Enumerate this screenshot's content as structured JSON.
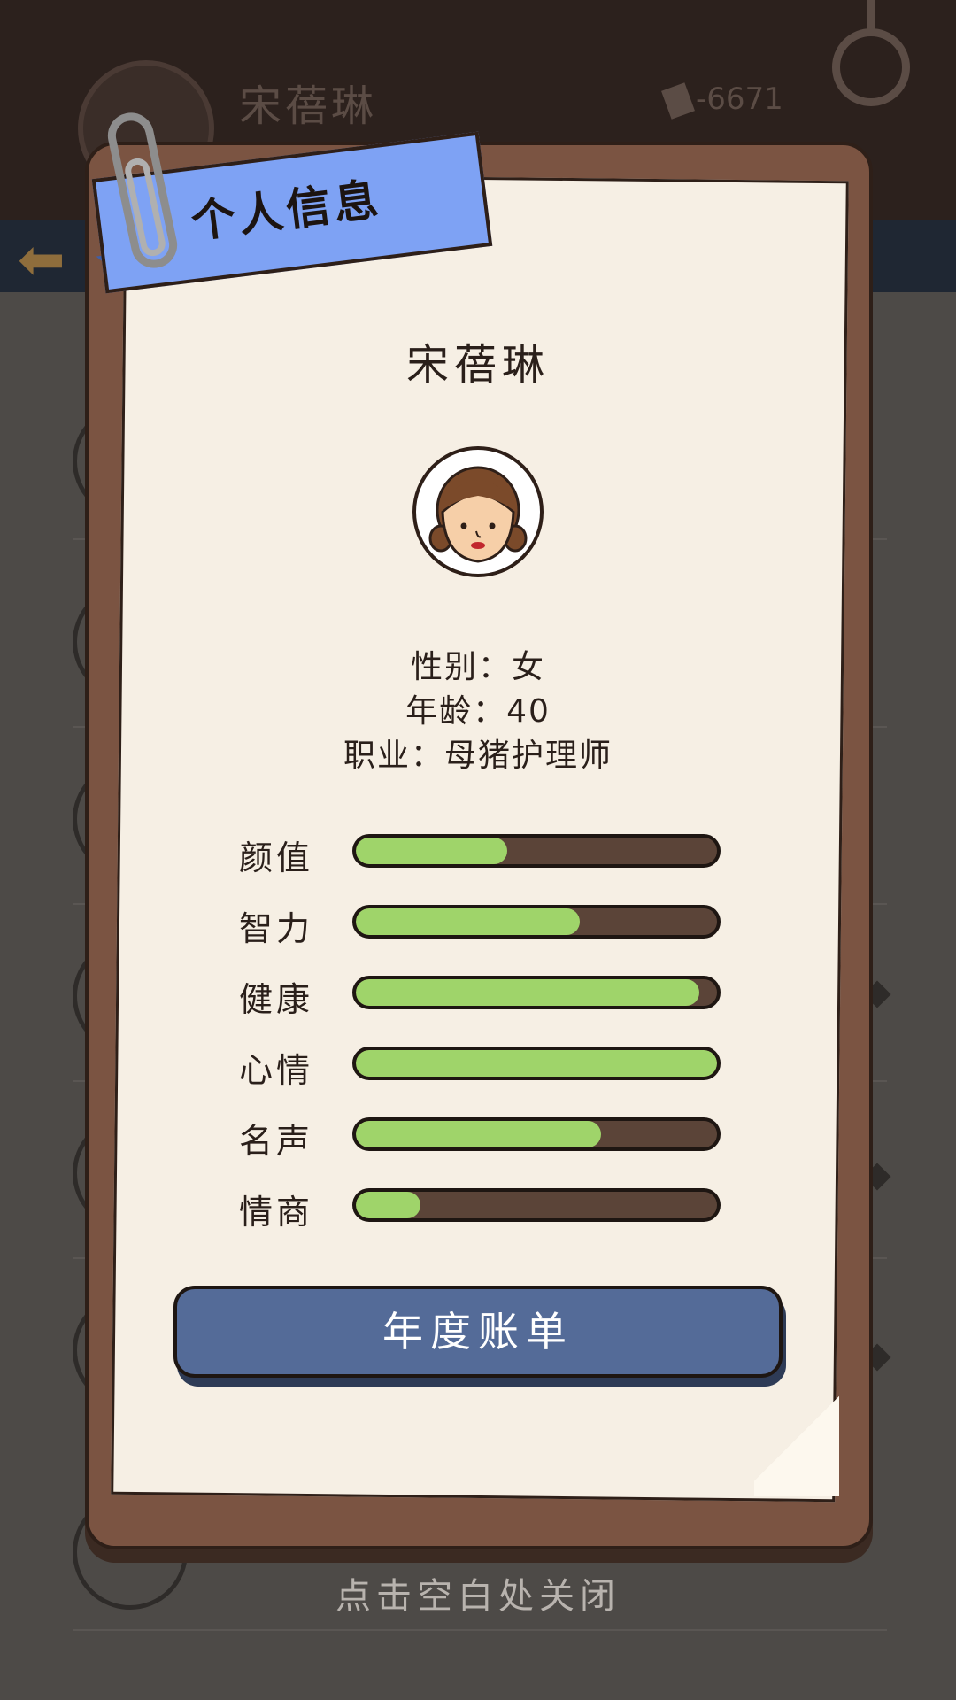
{
  "background": {
    "header_name": "宋蓓琳",
    "money": "-6671"
  },
  "panel": {
    "title": "个人信息",
    "name": "宋蓓琳",
    "gender_line": "性别：女",
    "age_line": "年龄：40",
    "job_line": "职业：母猪护理师",
    "stats": [
      {
        "label": "颜值",
        "value": 0.42
      },
      {
        "label": "智力",
        "value": 0.62
      },
      {
        "label": "健康",
        "value": 0.95
      },
      {
        "label": "心情",
        "value": 1.0
      },
      {
        "label": "名声",
        "value": 0.68
      },
      {
        "label": "情商",
        "value": 0.18
      }
    ],
    "annual_button": "年度账单",
    "close_hint": "点击空白处关闭"
  },
  "colors": {
    "bar_fill": "#9fd46a",
    "bar_track": "#5b4438",
    "button": "#546b98",
    "ribbon": "#7ea2f4",
    "frame": "#7b5442",
    "paper": "#f6efe4"
  }
}
